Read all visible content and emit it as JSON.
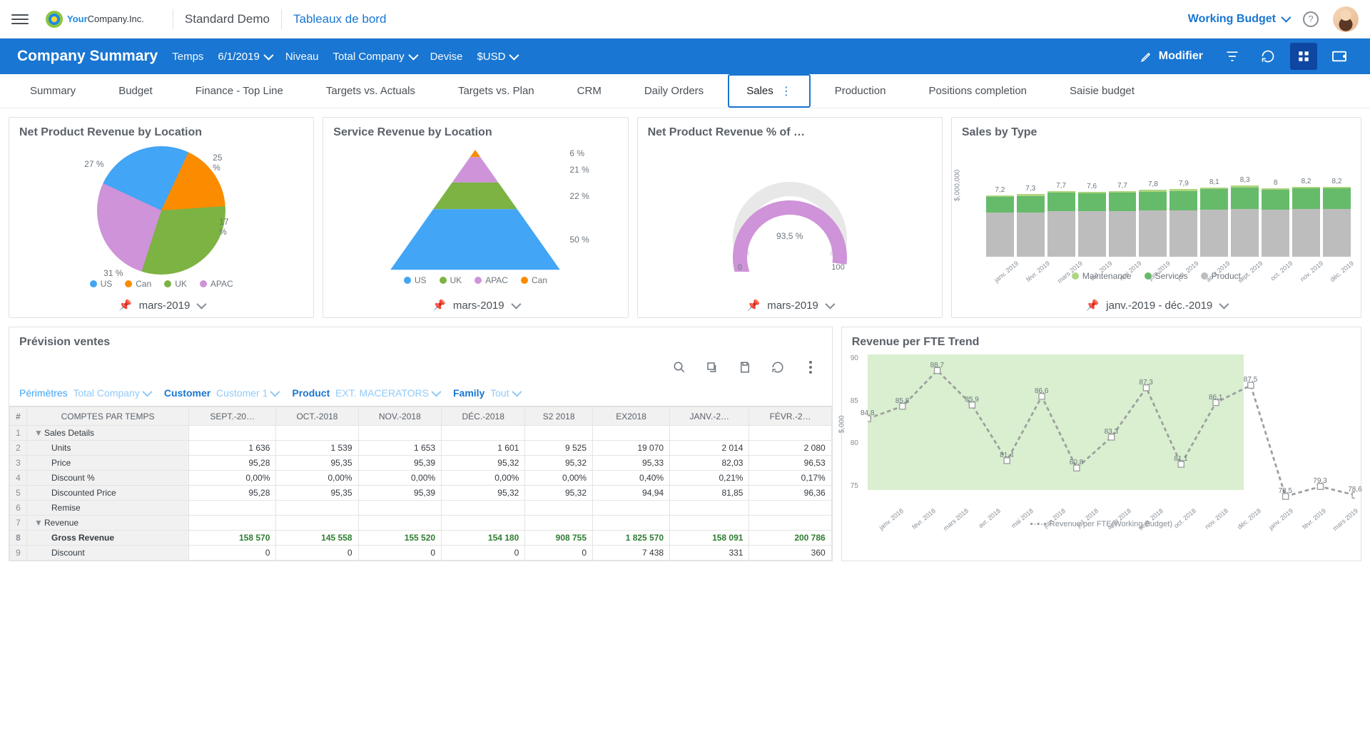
{
  "header": {
    "company": "YourCompany.Inc.",
    "context": "Standard Demo",
    "breadcrumb": "Tableaux de bord",
    "budget": "Working Budget"
  },
  "bluebar": {
    "title": "Company Summary",
    "time_label": "Temps",
    "time_value": "6/1/2019",
    "level_label": "Niveau",
    "level_value": "Total Company",
    "currency_label": "Devise",
    "currency_value": "$USD",
    "modify": "Modifier"
  },
  "tabs": [
    "Summary",
    "Budget",
    "Finance - Top Line",
    "Targets vs. Actuals",
    "Targets vs. Plan",
    "CRM",
    "Daily Orders",
    "Sales",
    "Production",
    "Positions completion",
    "Saisie budget"
  ],
  "active_tab": "Sales",
  "cards": {
    "pie": {
      "title": "Net Product Revenue by Location",
      "period": "mars-2019",
      "legend": [
        "US",
        "Can",
        "UK",
        "APAC"
      ],
      "colors": [
        "#42a5f5",
        "#fb8c00",
        "#7cb342",
        "#ce93d8"
      ]
    },
    "pyramid": {
      "title": "Service Revenue by Location",
      "period": "mars-2019",
      "legend": [
        "US",
        "UK",
        "APAC",
        "Can"
      ],
      "colors": [
        "#42a5f5",
        "#7cb342",
        "#ce93d8",
        "#fb8c00"
      ]
    },
    "gauge": {
      "title": "Net Product Revenue % of …",
      "period": "mars-2019",
      "value_label": "93,5 %",
      "min": "0",
      "max": "100"
    },
    "bars": {
      "title": "Sales by Type",
      "period": "janv.-2019 - déc.-2019",
      "ylabel": "$,000,000",
      "ymax": 10,
      "legend": [
        "Maintenance",
        "Services",
        "Product"
      ],
      "colors": [
        "#aed581",
        "#66bb6a",
        "#bdbdbd"
      ]
    },
    "forecast": {
      "title": "Prévision ventes",
      "filters": {
        "scope_label": "Périmètres",
        "scope_value": "Total Company",
        "customer_label": "Customer",
        "customer_value": "Customer 1",
        "product_label": "Product",
        "product_value": "EXT. MACERATORS",
        "family_label": "Family",
        "family_value": "Tout"
      },
      "columns": [
        "#",
        "COMPTES PAR TEMPS",
        "SEPT.-20…",
        "OCT.-2018",
        "NOV.-2018",
        "DÉC.-2018",
        "S2 2018",
        "EX2018",
        "JANV.-2…",
        "FÉVR.-2…"
      ],
      "rows": [
        {
          "n": "1",
          "label": "Sales Details",
          "indent": 0,
          "toggle": true,
          "vals": [
            "",
            "",
            "",
            "",
            "",
            "",
            "",
            ""
          ]
        },
        {
          "n": "2",
          "label": "Units",
          "indent": 1,
          "vals": [
            "1 636",
            "1 539",
            "1 653",
            "1 601",
            "9 525",
            "19 070",
            "2 014",
            "2 080"
          ]
        },
        {
          "n": "3",
          "label": "Price",
          "indent": 1,
          "vals": [
            "95,28",
            "95,35",
            "95,39",
            "95,32",
            "95,32",
            "95,33",
            "82,03",
            "96,53"
          ]
        },
        {
          "n": "4",
          "label": "Discount %",
          "indent": 1,
          "vals": [
            "0,00%",
            "0,00%",
            "0,00%",
            "0,00%",
            "0,00%",
            "0,40%",
            "0,21%",
            "0,17%"
          ]
        },
        {
          "n": "5",
          "label": "Discounted Price",
          "indent": 1,
          "vals": [
            "95,28",
            "95,35",
            "95,39",
            "95,32",
            "95,32",
            "94,94",
            "81,85",
            "96,36"
          ]
        },
        {
          "n": "6",
          "label": "Remise",
          "indent": 1,
          "vals": [
            "",
            "",
            "",
            "",
            "",
            "",
            "",
            ""
          ]
        },
        {
          "n": "7",
          "label": "Revenue",
          "indent": 0,
          "toggle": true,
          "vals": [
            "",
            "",
            "",
            "",
            "",
            "",
            "",
            ""
          ]
        },
        {
          "n": "8",
          "label": "Gross Revenue",
          "indent": 1,
          "bold": true,
          "grn": true,
          "vals": [
            "158 570",
            "145 558",
            "155 520",
            "154 180",
            "908 755",
            "1 825 570",
            "158 091",
            "200 786"
          ]
        },
        {
          "n": "9",
          "label": "Discount",
          "indent": 1,
          "vals": [
            "0",
            "0",
            "0",
            "0",
            "0",
            "7 438",
            "331",
            "360"
          ]
        }
      ]
    },
    "fte": {
      "title": "Revenue per FTE Trend",
      "ylabel": "$,000",
      "legend": "Revenue per FTE(Working Budget)"
    }
  },
  "chart_data": [
    {
      "type": "pie",
      "title": "Net Product Revenue by Location",
      "series": [
        {
          "name": "US",
          "value": 25
        },
        {
          "name": "Can",
          "value": 17
        },
        {
          "name": "UK",
          "value": 31
        },
        {
          "name": "APAC",
          "value": 27
        }
      ],
      "labels": [
        "25 %",
        "17 %",
        "31 %",
        "27 %"
      ]
    },
    {
      "type": "pyramid",
      "title": "Service Revenue by Location",
      "series": [
        {
          "name": "Can",
          "value": 6
        },
        {
          "name": "APAC",
          "value": 21
        },
        {
          "name": "UK",
          "value": 22
        },
        {
          "name": "US",
          "value": 50
        }
      ],
      "labels": [
        "6 %",
        "21 %",
        "22 %",
        "50 %"
      ]
    },
    {
      "type": "gauge",
      "title": "Net Product Revenue % of …",
      "value": 93.5,
      "min": 0,
      "max": 100
    },
    {
      "type": "bar",
      "title": "Sales by Type",
      "stacked": true,
      "ylabel": "$,000,000",
      "ylim": [
        0,
        10
      ],
      "categories": [
        "janv. 2019",
        "févr. 2019",
        "mars 2019",
        "avr. 2019",
        "mai 2019",
        "juin 2019",
        "juil. 2019",
        "août 2019",
        "sept. 2019",
        "oct. 2019",
        "nov. 2019",
        "déc. 2019"
      ],
      "totals": [
        7.2,
        7.3,
        7.7,
        7.6,
        7.7,
        7.8,
        7.9,
        8.1,
        8.3,
        8.0,
        8.2,
        8.2
      ],
      "series": [
        {
          "name": "Product",
          "values": [
            5.2,
            5.2,
            5.3,
            5.3,
            5.3,
            5.4,
            5.4,
            5.5,
            5.6,
            5.5,
            5.6,
            5.6
          ]
        },
        {
          "name": "Services",
          "values": [
            1.8,
            1.9,
            2.2,
            2.1,
            2.2,
            2.2,
            2.3,
            2.4,
            2.5,
            2.3,
            2.4,
            2.4
          ]
        },
        {
          "name": "Maintenance",
          "values": [
            0.2,
            0.2,
            0.2,
            0.2,
            0.2,
            0.2,
            0.2,
            0.2,
            0.2,
            0.2,
            0.2,
            0.2
          ]
        }
      ]
    },
    {
      "type": "line",
      "title": "Revenue per FTE Trend",
      "ylabel": "$,000",
      "ylim": [
        75,
        90
      ],
      "x": [
        "janv. 2018",
        "févr. 2018",
        "mars 2018",
        "avr. 2018",
        "mai 2018",
        "juin 2018",
        "juil. 2018",
        "août 2018",
        "sept. 2018",
        "oct. 2018",
        "nov. 2018",
        "déc. 2018",
        "janv. 2019",
        "févr. 2019",
        "mars 2019"
      ],
      "series": [
        {
          "name": "Revenue per FTE(Working Budget)",
          "values": [
            84.8,
            85.8,
            88.7,
            85.9,
            81.4,
            86.6,
            80.8,
            83.3,
            87.3,
            81.1,
            86.1,
            87.5,
            78.5,
            79.3,
            78.6
          ],
          "labels": [
            "84,8",
            "85,8",
            "88,7",
            "85,9",
            "81,4",
            "86,6",
            "80,8",
            "83,3",
            "87,3",
            "81,1",
            "86,1",
            "87,5",
            "78,5",
            "79,3",
            "78,6"
          ]
        }
      ]
    }
  ]
}
